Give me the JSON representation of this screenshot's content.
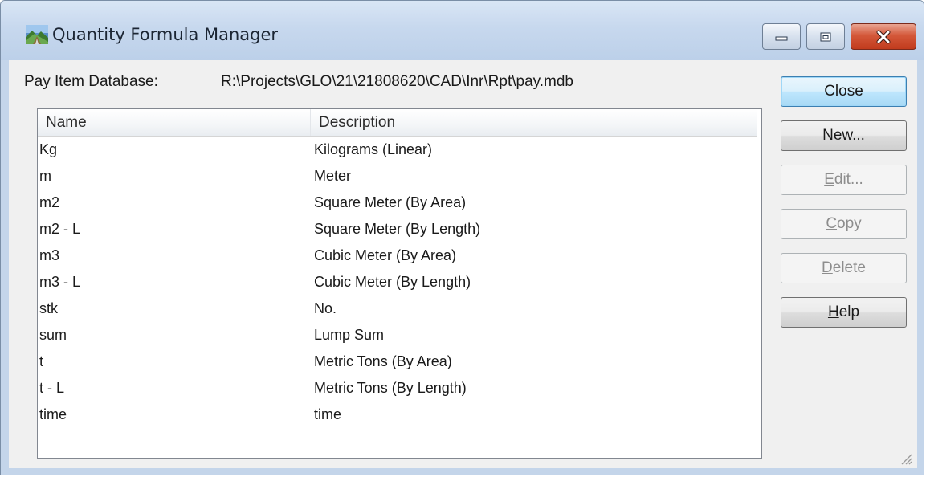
{
  "window": {
    "title": "Quantity Formula Manager",
    "app_icon": "landscape-app-icon",
    "controls": {
      "minimize_icon": "minimize-icon",
      "maximize_icon": "maximize-icon",
      "close_icon": "close-icon"
    }
  },
  "database": {
    "label": "Pay Item Database:",
    "path": "R:\\Projects\\GLO\\21\\21808620\\CAD\\Inr\\Rpt\\pay.mdb"
  },
  "table": {
    "columns": {
      "name": "Name",
      "description": "Description"
    },
    "rows": [
      {
        "name": "Kg",
        "description": "Kilograms (Linear)"
      },
      {
        "name": "m",
        "description": "Meter"
      },
      {
        "name": "m2",
        "description": "Square Meter (By Area)"
      },
      {
        "name": "m2 - L",
        "description": "Square Meter (By Length)"
      },
      {
        "name": "m3",
        "description": "Cubic Meter (By Area)"
      },
      {
        "name": "m3 - L",
        "description": "Cubic Meter (By Length)"
      },
      {
        "name": "stk",
        "description": "No."
      },
      {
        "name": "sum",
        "description": "Lump Sum"
      },
      {
        "name": "t",
        "description": "Metric Tons (By Area)"
      },
      {
        "name": "t - L",
        "description": "Metric Tons (By Length)"
      },
      {
        "name": "time",
        "description": "time"
      }
    ]
  },
  "buttons": {
    "close": {
      "label": "Close",
      "mnemonic": ""
    },
    "new": {
      "label": "New...",
      "mnemonic": "N"
    },
    "edit": {
      "label": "Edit...",
      "mnemonic": "E"
    },
    "copy": {
      "label": "Copy",
      "mnemonic": "C"
    },
    "delete": {
      "label": "Delete",
      "mnemonic": "D"
    },
    "help": {
      "label": "Help",
      "mnemonic": "H"
    }
  },
  "colors": {
    "titlebar": "#c7d8ee",
    "close_button": "#c13b1d",
    "default_button": "#bee6fd",
    "dialog_background": "#f0f0f0"
  }
}
